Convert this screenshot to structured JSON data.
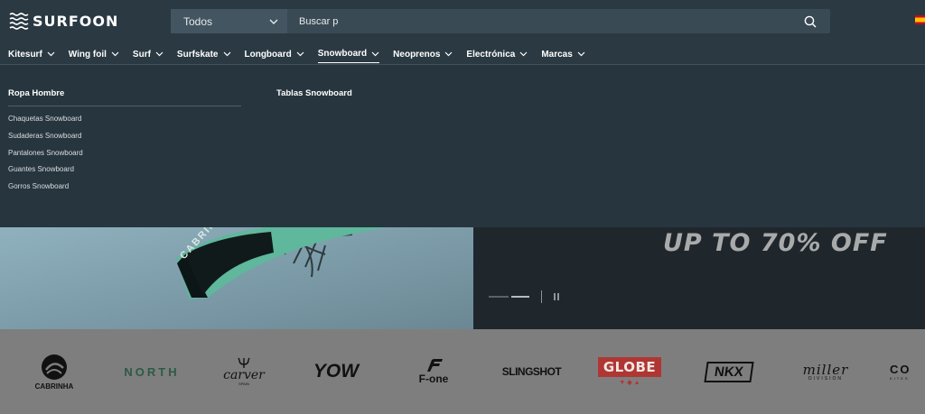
{
  "header": {
    "logo_text": "SURFOON",
    "search": {
      "category_value": "Todos",
      "input_value": "Buscar p",
      "placeholder": "Buscar p"
    },
    "flag_icon": "spain-flag-icon"
  },
  "nav": {
    "items": [
      {
        "label": "Kitesurf"
      },
      {
        "label": "Wing foil"
      },
      {
        "label": "Surf"
      },
      {
        "label": "Surfskate"
      },
      {
        "label": "Longboard"
      },
      {
        "label": "Snowboard",
        "active": true
      },
      {
        "label": "Neoprenos"
      },
      {
        "label": "Electrónica"
      },
      {
        "label": "Marcas"
      }
    ]
  },
  "mega_menu": {
    "columns": [
      {
        "title": "Ropa Hombre",
        "links": [
          "Chaquetas Snowboard",
          "Sudaderas Snowboard",
          "Pantalones Snowboard",
          "Guantes Snowboard",
          "Gorros Snowboard"
        ]
      },
      {
        "title": "Tablas Snowboard",
        "links": []
      }
    ]
  },
  "hero": {
    "promo_text": "UP TO 70% OFF",
    "kite_print": "CABRINHA",
    "slider": {
      "slide_count": 2,
      "active_slide": 2
    }
  },
  "brands": {
    "cabrinha": "CABRINHA",
    "north": "NORTH",
    "carver": "carver",
    "carver_sub": "SPAIN",
    "yow": "YOW",
    "fone": "F-one",
    "slingshot": "SLINGSHOT",
    "globe": "GLOBE",
    "nkx": "NKX",
    "miller": "miller",
    "miller_sub": "DIVISION",
    "cut_text": "CO",
    "cut_sub": "KITES"
  },
  "colors": {
    "header_bg": "#2a3942",
    "menu_bg": "#27353e",
    "brand_strip_bg": "#7e7e7e",
    "globe_red": "#b03633",
    "north_green": "#2d5a45"
  }
}
